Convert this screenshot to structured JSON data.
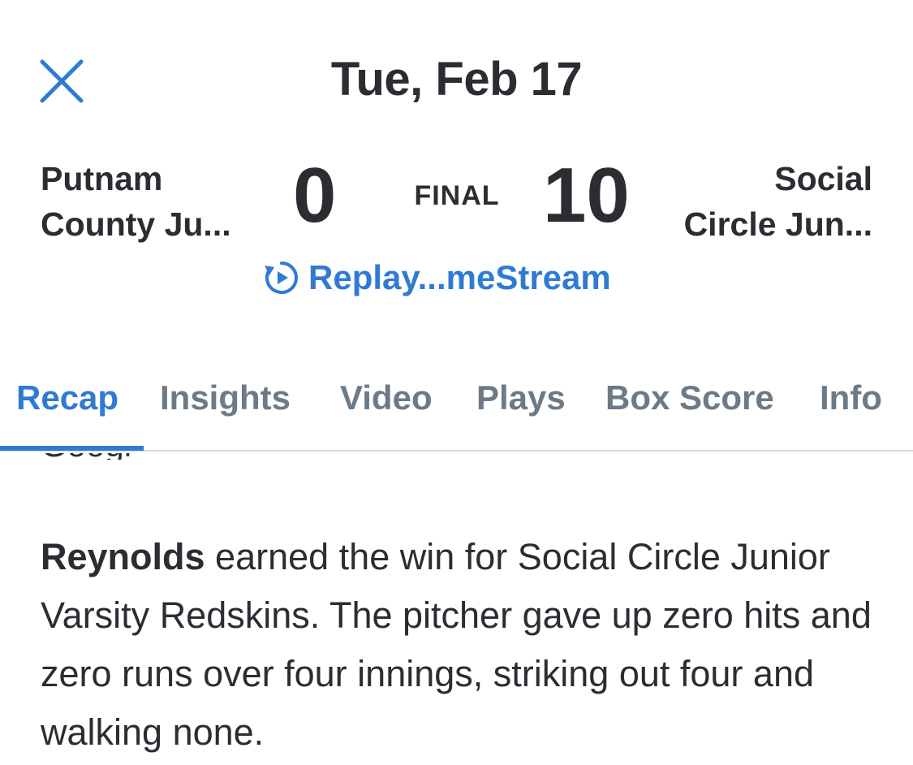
{
  "header": {
    "close_icon": "close-icon",
    "title": "Tue, Feb 17"
  },
  "game": {
    "away_team": {
      "name_line1": "Putnam",
      "name_line2": "County Ju...",
      "score": "0"
    },
    "home_team": {
      "name_line1": "Social",
      "name_line2": "Circle Jun...",
      "score": "10"
    },
    "status": "FINAL",
    "replay": {
      "icon": "replay-play-icon",
      "label": "Replay...meStream"
    }
  },
  "tabs": [
    {
      "label": "Recap",
      "active": true
    },
    {
      "label": "Insights",
      "active": false
    },
    {
      "label": "Video",
      "active": false
    },
    {
      "label": "Plays",
      "active": false
    },
    {
      "label": "Box Score",
      "active": false
    },
    {
      "label": "Info",
      "active": false
    }
  ],
  "recap": {
    "partial_line_above": "Google",
    "player": "Reynolds",
    "text": " earned the win for Social Circle Junior Varsity Redskins. The pitcher gave up zero hits and zero runs over four innings, striking out four and walking none."
  },
  "colors": {
    "accent": "#2f7bd3",
    "text_primary": "#2b2d33",
    "tab_inactive": "#6c7a88",
    "divider": "#d7d9dd"
  }
}
